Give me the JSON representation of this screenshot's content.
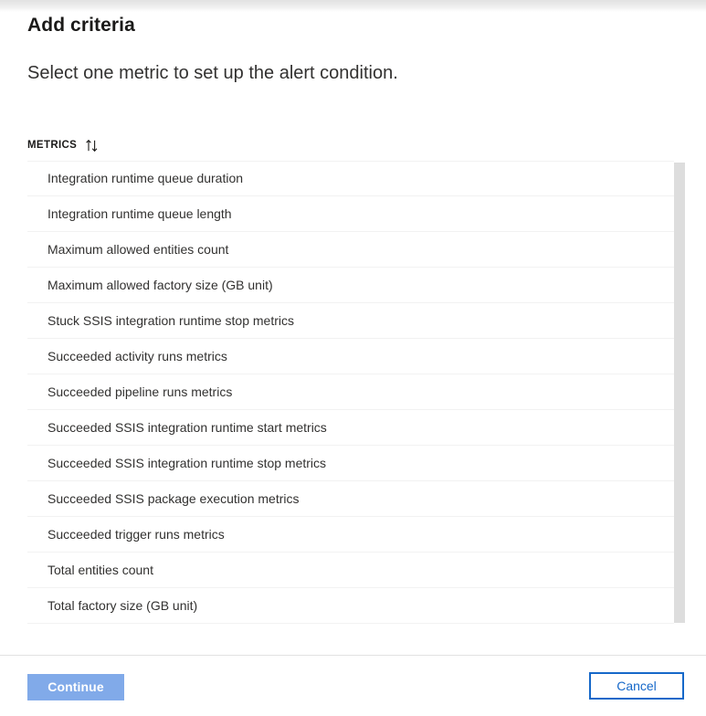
{
  "blade": {
    "title": "Add criteria",
    "subtitle": "Select one metric to set up the alert condition."
  },
  "list": {
    "column_header": "METRICS",
    "sort_icon": "sort-ascending-descending-icon",
    "rows": [
      {
        "label": "Integration runtime queue duration"
      },
      {
        "label": "Integration runtime queue length"
      },
      {
        "label": "Maximum allowed entities count"
      },
      {
        "label": "Maximum allowed factory size (GB unit)"
      },
      {
        "label": "Stuck SSIS integration runtime stop metrics"
      },
      {
        "label": "Succeeded activity runs metrics"
      },
      {
        "label": "Succeeded pipeline runs metrics"
      },
      {
        "label": "Succeeded SSIS integration runtime start metrics"
      },
      {
        "label": "Succeeded SSIS integration runtime stop metrics"
      },
      {
        "label": "Succeeded SSIS package execution metrics"
      },
      {
        "label": "Succeeded trigger runs metrics"
      },
      {
        "label": "Total entities count"
      },
      {
        "label": "Total factory size (GB unit)"
      }
    ]
  },
  "footer": {
    "continue_label": "Continue",
    "cancel_label": "Cancel"
  },
  "colors": {
    "primary_disabled": "#81aae9",
    "accent_border": "#1668c9",
    "accent_text": "#1668c9",
    "row_separator": "#f2f2f2",
    "scrollbar_thumb": "#dddddd",
    "footer_divider": "#e2e2e2",
    "text_primary": "#1b1a19",
    "text_secondary": "#323130"
  }
}
